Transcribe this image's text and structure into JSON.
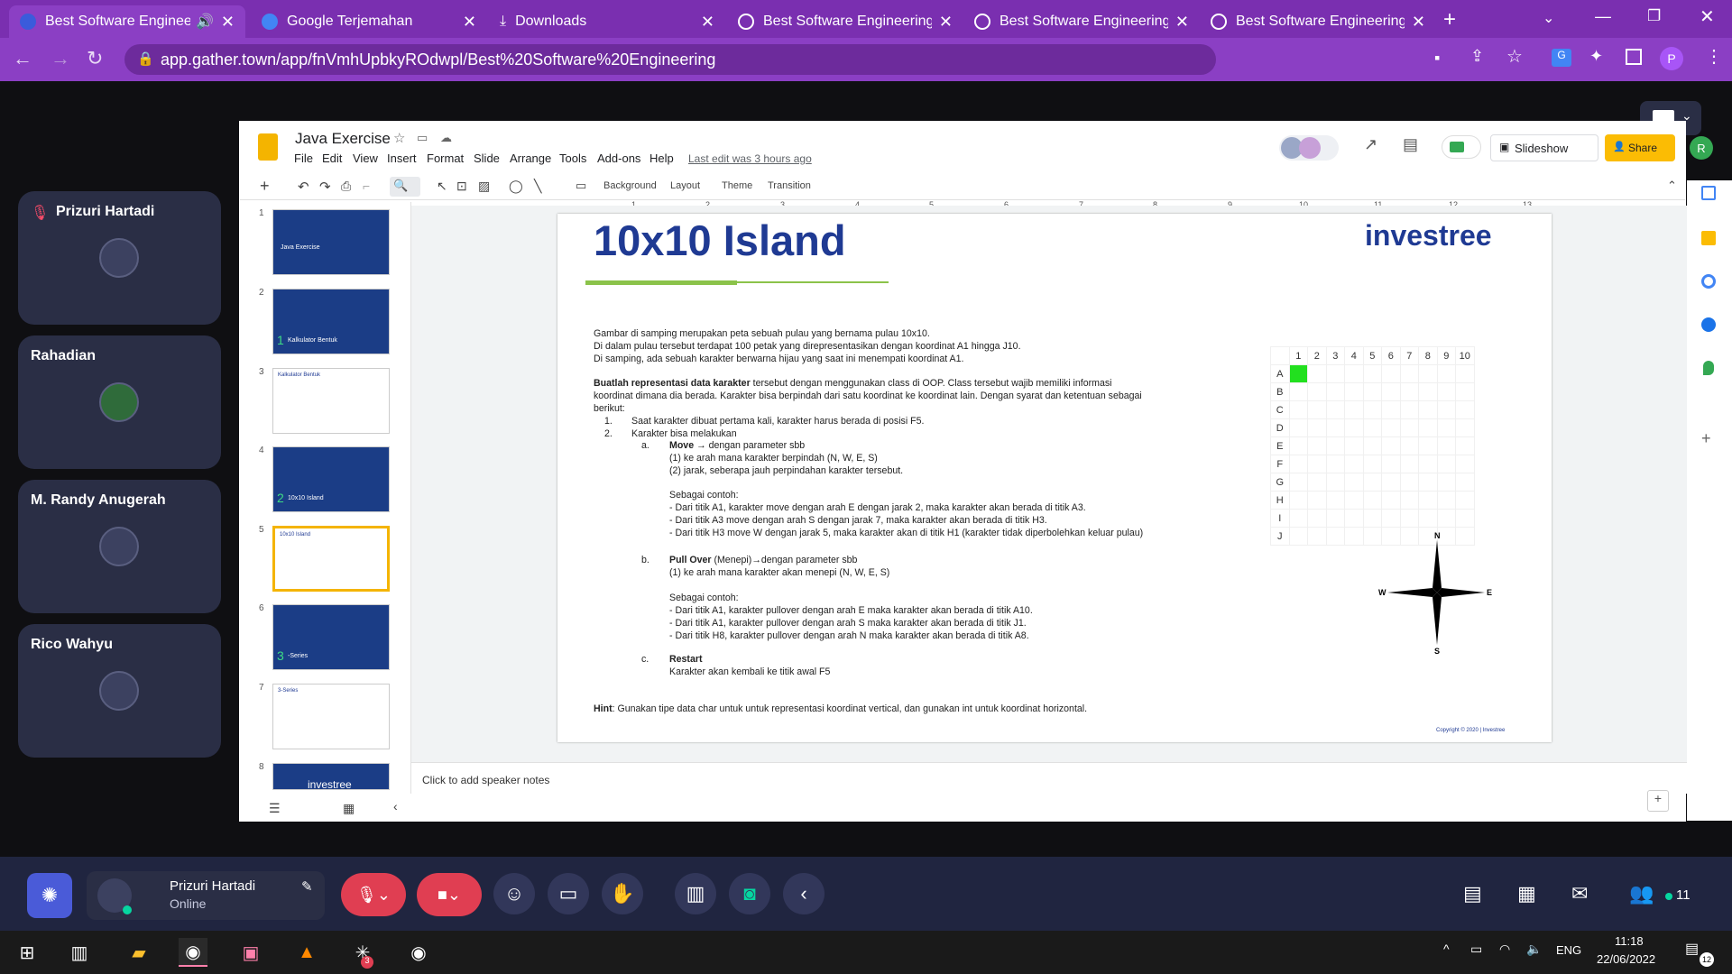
{
  "browser": {
    "tabs": [
      {
        "label": "Best Software Engineen",
        "active": true
      },
      {
        "label": "Google Terjemahan"
      },
      {
        "label": "Downloads"
      },
      {
        "label": "Best Software Engineering"
      },
      {
        "label": "Best Software Engineering"
      },
      {
        "label": "Best Software Engineering"
      }
    ],
    "url": "app.gather.town/app/fnVmhUpbkyROdwpl/Best%20Software%20Engineering",
    "profile_initial": "P"
  },
  "participants": [
    {
      "name": "Prizuri Hartadi",
      "muted": true
    },
    {
      "name": "Rahadian"
    },
    {
      "name": "M. Randy Anugerah"
    },
    {
      "name": "Rico Wahyu"
    }
  ],
  "slides_app": {
    "doc_title": "Java Exercise",
    "menu": [
      "File",
      "Edit",
      "View",
      "Insert",
      "Format",
      "Slide",
      "Arrange",
      "Tools",
      "Add-ons",
      "Help"
    ],
    "last_edit": "Last edit was 3 hours ago",
    "toolbar": {
      "background": "Background",
      "layout": "Layout",
      "theme": "Theme",
      "transition": "Transition"
    },
    "slideshow_label": "Slideshow",
    "share_label": "Share",
    "account_initial": "R",
    "speaker_notes_placeholder": "Click to add speaker notes",
    "ruler_numbers": [
      "1",
      "2",
      "3",
      "4",
      "5",
      "6",
      "7",
      "8",
      "9",
      "10",
      "11",
      "12",
      "13"
    ],
    "thumbnails": [
      {
        "num": "1",
        "label": "Java Exercise"
      },
      {
        "num": "2",
        "label": "Kalkulator Bentuk",
        "prefix": "1"
      },
      {
        "num": "3",
        "label": "Kalkulator Bentuk"
      },
      {
        "num": "4",
        "label": "10x10 Island",
        "prefix": "2"
      },
      {
        "num": "5",
        "label": "10x10 Island",
        "selected": true
      },
      {
        "num": "6",
        "label": "-Series",
        "prefix": "3"
      },
      {
        "num": "7",
        "label": "3-Series"
      },
      {
        "num": "8",
        "label": "investree"
      }
    ]
  },
  "slide": {
    "title": "10x10 Island",
    "logo": "investree",
    "intro": [
      "Gambar di samping merupakan peta sebuah pulau yang bernama pulau 10x10.",
      "Di dalam pulau tersebut terdapat 100 petak yang direpresentasikan dengan koordinat A1 hingga J10.",
      "Di samping, ada sebuah karakter berwarna hijau yang saat ini menempati koordinat A1."
    ],
    "task_bold": "Buatlah representasi data karakter",
    "task_rest_1": " tersebut dengan menggunakan class di OOP. Class tersebut wajib memiliki informasi",
    "task_rest_2": "koordinat dimana dia berada. Karakter bisa berpindah dari satu koordinat ke koordinat lain. Dengan syarat dan ketentuan sebagai",
    "task_rest_3": "berikut:",
    "rule_1_num": "1.",
    "rule_1": "Saat karakter dibuat pertama kali, karakter harus berada di posisi F5.",
    "rule_2_num": "2.",
    "rule_2": "Karakter bisa melakukan",
    "a_num": "a.",
    "a_title": "Move",
    "a_title_rest": " → dengan parameter sbb",
    "a_p1": "(1) ke arah mana karakter berpindah (N, W, E, S)",
    "a_p2": "(2) jarak, seberapa jauh perpindahan karakter tersebut.",
    "a_ex_label": "Sebagai contoh:",
    "a_ex": [
      "- Dari titik A1, karakter move dengan arah E dengan jarak 2, maka karakter akan berada di titik A3.",
      "- Dari titik A3 move dengan arah S dengan jarak 7, maka karakter akan berada di titik H3.",
      "- Dari titik H3 move W dengan jarak 5, maka karakter akan di titik H1 (karakter tidak diperbolehkan keluar pulau)"
    ],
    "b_num": "b.",
    "b_title": "Pull Over",
    "b_title_rest": " (Menepi)→dengan parameter sbb",
    "b_p1": "(1) ke arah mana karakter akan menepi (N, W, E, S)",
    "b_ex_label": "Sebagai contoh:",
    "b_ex": [
      "- Dari titik A1, karakter pullover dengan arah E maka karakter akan berada di titik A10.",
      "- Dari titik A1, karakter pullover dengan arah S maka karakter akan berada di titik J1.",
      "- Dari titik H8, karakter pullover dengan arah N maka karakter akan berada di titik A8."
    ],
    "c_num": "c.",
    "c_title": "Restart",
    "c_p1": "Karakter akan kembali ke titik awal F5",
    "hint_label": "Hint",
    "hint_text": ": Gunakan tipe data char untuk untuk representasi koordinat vertical, dan gunakan int untuk koordinat horizontal.",
    "copyright": "Copyright © 2020  |  Investree",
    "grid_cols": [
      "1",
      "2",
      "3",
      "4",
      "5",
      "6",
      "7",
      "8",
      "9",
      "10"
    ],
    "grid_rows": [
      "A",
      "B",
      "C",
      "D",
      "E",
      "F",
      "G",
      "H",
      "I",
      "J"
    ],
    "character_cell": "A1",
    "compass": {
      "n": "N",
      "s": "S",
      "e": "E",
      "w": "W"
    }
  },
  "gather_bar": {
    "user_name": "Prizuri Hartadi",
    "status": "Online",
    "participant_count": "11"
  },
  "taskbar": {
    "lang": "ENG",
    "time": "11:18",
    "date": "22/06/2022",
    "notif_count": "12",
    "badge_count": "3"
  },
  "colors": {
    "chrome": "#8b3fc4",
    "gather_dark": "#202540",
    "character": "#22e01f",
    "title": "#1f3a93",
    "share": "#fbbc04"
  }
}
